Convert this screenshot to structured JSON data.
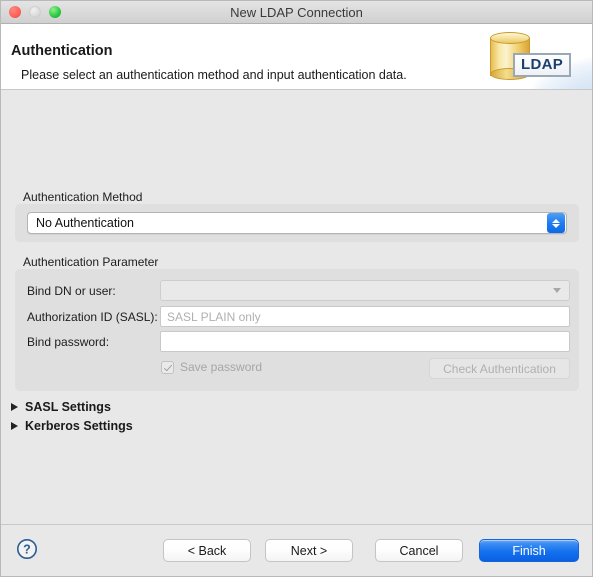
{
  "window": {
    "title": "New LDAP Connection",
    "controls": {
      "close": "close-button",
      "minimize": "minimize-button",
      "maximize": "maximize-button"
    }
  },
  "header": {
    "title": "Authentication",
    "subtitle": "Please select an authentication method and input authentication data.",
    "icon_label": "LDAP"
  },
  "auth_method": {
    "group_label": "Authentication Method",
    "selected": "No Authentication",
    "options": [
      "No Authentication"
    ]
  },
  "auth_parameter": {
    "group_label": "Authentication Parameter",
    "fields": [
      {
        "label": "Bind DN or user:",
        "value": "",
        "placeholder": "",
        "type": "combo",
        "enabled": false
      },
      {
        "label": "Authorization ID (SASL):",
        "value": "",
        "placeholder": "SASL PLAIN only",
        "type": "text",
        "enabled": false
      },
      {
        "label": "Bind password:",
        "value": "",
        "placeholder": "",
        "type": "password",
        "enabled": false
      }
    ],
    "save_password": {
      "label": "Save password",
      "checked": true,
      "enabled": false
    },
    "check_button": {
      "label": "Check Authentication",
      "enabled": false
    }
  },
  "sections": [
    {
      "label": "SASL Settings",
      "expanded": false
    },
    {
      "label": "Kerberos Settings",
      "expanded": false
    }
  ],
  "footer": {
    "help": "?",
    "buttons": [
      {
        "label": "< Back",
        "primary": false
      },
      {
        "label": "Next >",
        "primary": false
      },
      {
        "label": "Cancel",
        "primary": false
      },
      {
        "label": "Finish",
        "primary": true
      }
    ]
  },
  "colors": {
    "accent": "#1472ee",
    "window_bg": "#e8e8e8",
    "group_bg": "#dfdfdf",
    "header_bg": "#ffffff",
    "disabled_text": "#b0b0b0"
  }
}
